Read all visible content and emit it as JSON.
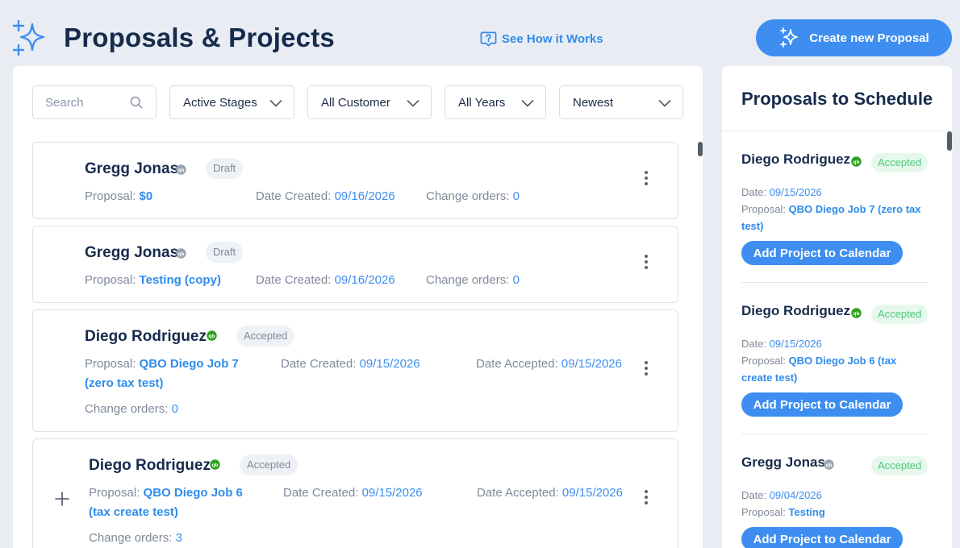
{
  "header": {
    "title": "Proposals & Projects",
    "how_link": "See How it Works",
    "create_button": "Create new Proposal"
  },
  "filters": {
    "search_placeholder": "Search",
    "stage": "Active Stages",
    "customer": "All Customer",
    "year": "All Years",
    "sort": "Newest"
  },
  "labels": {
    "proposal": "Proposal:",
    "date_created": "Date Created:",
    "date_accepted": "Date Accepted:",
    "change_orders": "Change orders:",
    "date": "Date:"
  },
  "cards": [
    {
      "customer": "Gregg Jonas",
      "status": "Draft",
      "proposal": "$0",
      "date_created": "09/16/2026",
      "change_orders": "0",
      "qb_linked": false
    },
    {
      "customer": "Gregg Jonas",
      "status": "Draft",
      "proposal": "Testing (copy)",
      "date_created": "09/16/2026",
      "change_orders": "0",
      "qb_linked": false
    },
    {
      "customer": "Diego Rodriguez",
      "status": "Accepted",
      "proposal": "QBO Diego Job 7 (zero tax test)",
      "date_created": "09/15/2026",
      "date_accepted": "09/15/2026",
      "change_orders": "0",
      "qb_linked": true
    },
    {
      "customer": "Diego Rodriguez",
      "status": "Accepted",
      "proposal": "QBO Diego Job 6 (tax create test)",
      "date_created": "09/15/2026",
      "date_accepted": "09/15/2026",
      "change_orders": "3",
      "qb_linked": true
    }
  ],
  "schedule": {
    "title": "Proposals to Schedule",
    "button_label": "Add Project to Calendar",
    "items": [
      {
        "customer": "Diego Rodriguez",
        "status": "Accepted",
        "date": "09/15/2026",
        "proposal": "QBO Diego Job 7 (zero tax test)",
        "qb_linked": true
      },
      {
        "customer": "Diego Rodriguez",
        "status": "Accepted",
        "date": "09/15/2026",
        "proposal": "QBO Diego Job 6 (tax create test)",
        "qb_linked": true
      },
      {
        "customer": "Gregg Jonas",
        "status": "Accepted",
        "date": "09/04/2026",
        "proposal": "Testing",
        "qb_linked": false
      }
    ]
  },
  "colors": {
    "accent": "#3d8ef0",
    "qb_linked": "#2ca01c",
    "qb_unlinked": "#9aa3b0",
    "accepted_green": "#4bc97a"
  }
}
